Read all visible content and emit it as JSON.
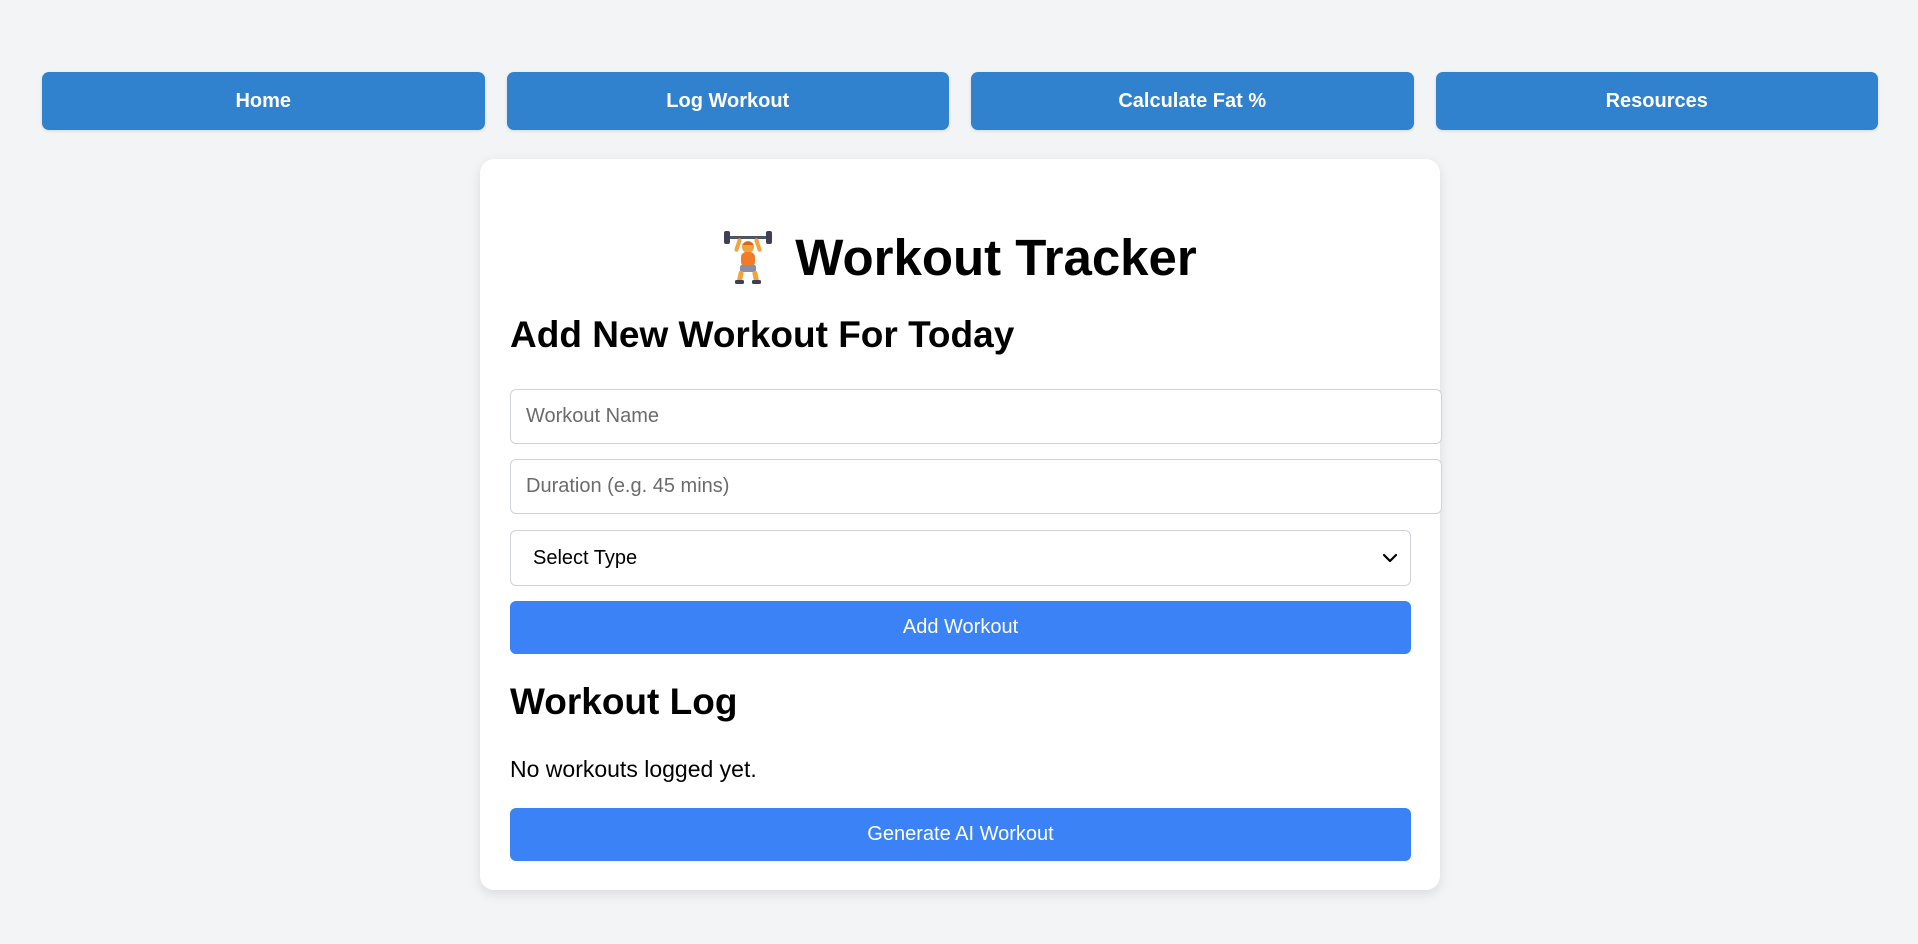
{
  "nav": {
    "items": [
      {
        "label": "Home"
      },
      {
        "label": "Log Workout"
      },
      {
        "label": "Calculate Fat %"
      },
      {
        "label": "Resources"
      }
    ]
  },
  "header": {
    "icon": "weightlifter-icon",
    "title": "Workout Tracker"
  },
  "form": {
    "heading": "Add New Workout For Today",
    "workout_name": {
      "value": "",
      "placeholder": "Workout Name"
    },
    "duration": {
      "value": "",
      "placeholder": "Duration (e.g. 45 mins)"
    },
    "type_select": {
      "selected": "Select Type"
    },
    "submit_label": "Add Workout"
  },
  "log": {
    "heading": "Workout Log",
    "empty_message": "No workouts logged yet.",
    "generate_label": "Generate AI Workout"
  },
  "colors": {
    "background": "#f3f4f6",
    "nav_button": "#3182ce",
    "primary_button": "#3b82f6",
    "card": "#ffffff"
  }
}
